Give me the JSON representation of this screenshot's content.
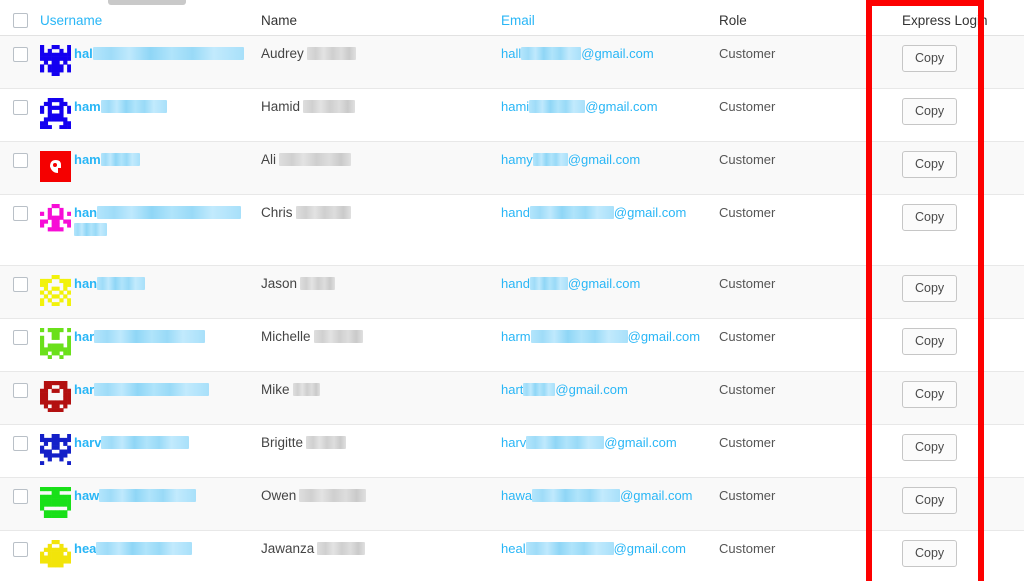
{
  "table": {
    "columns": [
      {
        "key": "checkbox",
        "label": "",
        "is_link": false
      },
      {
        "key": "username",
        "label": "Username",
        "is_link": true
      },
      {
        "key": "name",
        "label": "Name",
        "is_link": false
      },
      {
        "key": "email",
        "label": "Email",
        "is_link": true
      },
      {
        "key": "role",
        "label": "Role",
        "is_link": false
      },
      {
        "key": "express_login",
        "label": "Express Login",
        "is_link": false
      }
    ],
    "headers": {
      "username": "Username",
      "name": "Name",
      "email": "Email",
      "role": "Role",
      "express_login": "Express Login"
    },
    "copy_button_label": "Copy",
    "email_domain": "@gmail.com",
    "rows": [
      {
        "username_prefix": "hal",
        "username_redacted_width": 151,
        "username_redacted_width2": 0,
        "name": "Audrey",
        "name_redacted_width": 49,
        "email_prefix": "hall",
        "email_redacted_width": 60,
        "role": "Customer",
        "avatar_color": "#1400f0",
        "avatar_pattern": "identicon-star",
        "copy_label": "Copy"
      },
      {
        "username_prefix": "ham",
        "username_redacted_width": 66,
        "username_redacted_width2": 0,
        "name": "Hamid",
        "name_redacted_width": 52,
        "email_prefix": "hami",
        "email_redacted_width": 56,
        "role": "Customer",
        "avatar_color": "#1400f0",
        "avatar_pattern": "identicon-dots",
        "copy_label": "Copy"
      },
      {
        "username_prefix": "ham",
        "username_redacted_width": 39,
        "username_redacted_width2": 0,
        "name": "Ali",
        "name_redacted_width": 72,
        "email_prefix": "hamy",
        "email_redacted_width": 35,
        "role": "Customer",
        "avatar_color": "#f50000",
        "avatar_pattern": "solid-glyph",
        "copy_label": "Copy"
      },
      {
        "username_prefix": "han",
        "username_redacted_width": 144,
        "username_redacted_width2": 33,
        "name": "Chris",
        "name_redacted_width": 55,
        "email_prefix": "hand",
        "email_redacted_width": 84,
        "role": "Customer",
        "avatar_color": "#f70cd6",
        "avatar_pattern": "identicon-star",
        "copy_label": "Copy"
      },
      {
        "username_prefix": "han",
        "username_redacted_width": 48,
        "username_redacted_width2": 0,
        "name": "Jason",
        "name_redacted_width": 35,
        "email_prefix": "hand",
        "email_redacted_width": 38,
        "role": "Customer",
        "avatar_color": "#f2f20a",
        "avatar_pattern": "identicon-dots",
        "copy_label": "Copy"
      },
      {
        "username_prefix": "har",
        "username_redacted_width": 111,
        "username_redacted_width2": 0,
        "name": "Michelle",
        "name_redacted_width": 49,
        "email_prefix": "harm",
        "email_redacted_width": 97,
        "role": "Customer",
        "avatar_color": "#6ae01a",
        "avatar_pattern": "identicon-dots",
        "copy_label": "Copy"
      },
      {
        "username_prefix": "har",
        "username_redacted_width": 115,
        "username_redacted_width2": 0,
        "name": "Mike",
        "name_redacted_width": 27,
        "email_prefix": "hart",
        "email_redacted_width": 32,
        "role": "Customer",
        "avatar_color": "#b31010",
        "avatar_pattern": "identicon-box",
        "copy_label": "Copy"
      },
      {
        "username_prefix": "harv",
        "username_redacted_width": 88,
        "username_redacted_width2": 0,
        "name": "Brigitte",
        "name_redacted_width": 40,
        "email_prefix": "harv",
        "email_redacted_width": 78,
        "role": "Customer",
        "avatar_color": "#1420c8",
        "avatar_pattern": "identicon-star",
        "copy_label": "Copy"
      },
      {
        "username_prefix": "haw",
        "username_redacted_width": 97,
        "username_redacted_width2": 0,
        "name": "Owen",
        "name_redacted_width": 67,
        "email_prefix": "hawa",
        "email_redacted_width": 88,
        "role": "Customer",
        "avatar_color": "#18e018",
        "avatar_pattern": "identicon-dots",
        "copy_label": "Copy"
      },
      {
        "username_prefix": "hea",
        "username_redacted_width": 96,
        "username_redacted_width2": 0,
        "name": "Jawanza",
        "name_redacted_width": 48,
        "email_prefix": "heal",
        "email_redacted_width": 88,
        "role": "Customer",
        "avatar_color": "#f2e40a",
        "avatar_pattern": "identicon-star",
        "copy_label": "Copy"
      }
    ]
  },
  "annotation": {
    "highlight_color": "#fd0000",
    "highlight_target": "express_login_column"
  }
}
